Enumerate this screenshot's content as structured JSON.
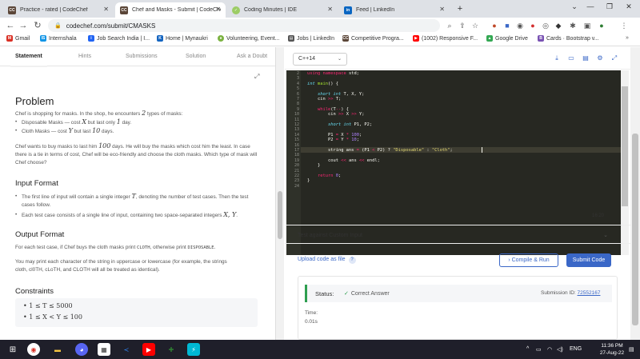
{
  "tabs": [
    {
      "title": "Practice - rated | CodeChef",
      "icon": "codechef-icon",
      "color": "#5b4638"
    },
    {
      "title": "Chef and Masks - Submit | CodeChef",
      "icon": "codechef-icon",
      "color": "#5b4638",
      "active": true
    },
    {
      "title": "Coding Minutes | IDE",
      "icon": "check-icon",
      "color": "#9ccc65"
    },
    {
      "title": "Feed | LinkedIn",
      "icon": "linkedin-icon",
      "color": "#0a66c2"
    }
  ],
  "address": {
    "url": "codechef.com/submit/CMASKS"
  },
  "bookmarks": [
    {
      "label": "Gmail",
      "icon": "gmail-icon",
      "color": "#d93025"
    },
    {
      "label": "Internshala",
      "icon": "internshala-icon",
      "color": "#1295e6"
    },
    {
      "label": "Job Search India | I...",
      "icon": "indeed-icon",
      "color": "#2164f3"
    },
    {
      "label": "Home | Mynaukri",
      "icon": "mynaukri-icon",
      "color": "#1565c0"
    },
    {
      "label": "Volunteering, Event...",
      "icon": "volunteer-icon",
      "color": "#7cb342"
    },
    {
      "label": "Jobs | LinkedIn",
      "icon": "briefcase-icon",
      "color": "#555555"
    },
    {
      "label": "Competitive Progra...",
      "icon": "codechef-icon",
      "color": "#5b4638"
    },
    {
      "label": "(1002) Responsive F...",
      "icon": "youtube-icon",
      "color": "#ff0000"
    },
    {
      "label": "Google Drive",
      "icon": "drive-icon",
      "color": "#34a853"
    },
    {
      "label": "Cards · Bootstrap v...",
      "icon": "bootstrap-icon",
      "color": "#7952b3"
    }
  ],
  "problem_tabs": [
    "Statement",
    "Hints",
    "Submissions",
    "Solution",
    "Ask a Doubt"
  ],
  "problem": {
    "title": "Problem",
    "intro_a": "Chef is shopping for masks. In the shop, he encounters",
    "intro_n": "2",
    "intro_b": "types of masks:",
    "mask1_a": "Disposable Masks — cost",
    "mask1_v": "X",
    "mask1_b": "but last only",
    "mask1_n": "1",
    "mask1_c": "day.",
    "mask2_a": "Cloth Masks — cost",
    "mask2_v": "Y",
    "mask2_b": "but last",
    "mask2_n": "10",
    "mask2_c": "days.",
    "body_a": "Chef wants to buy masks to last him",
    "body_n": "100",
    "body_b": "days. He will buy the masks which cost him the least. In case there is a tie in terms of cost, Chef will be eco-friendly and choose the cloth masks. Which type of mask will Chef choose?",
    "input_title": "Input Format",
    "input1_a": "The first line of input will contain a single integer",
    "input1_v": "T",
    "input1_b": ", denoting the number of test cases. Then the test cases follow.",
    "input2_a": "Each test case consists of a single line of input, containing two space-separated integers",
    "input2_v": "X, Y",
    "input2_b": ".",
    "output_title": "Output Format",
    "output_a": "For each test case, if Chef buys the cloth masks print",
    "output_cloth": "CLOTH",
    "output_b": ", otherwise print",
    "output_disp": "DISPOSABLE",
    "output_c": ".",
    "case_a": "You may print each character of the string in uppercase or lowercase (for example, the strings",
    "case_b": "cloth, cl0TH, cLoTH, and CLOTH will all be treated as identical).",
    "constraints_title": "Constraints",
    "constraint1": "1 ≤ T ≤ 5000",
    "constraint2": "1 ≤ X < Y ≤ 100"
  },
  "editor": {
    "language": "C++14",
    "cursor_position": "16:20",
    "line_numbers": [
      "2",
      "3",
      "4",
      "5",
      "6",
      "7",
      "8",
      "9",
      "10",
      "11",
      "12",
      "13",
      "14",
      "15",
      "16",
      "17",
      "18",
      "19",
      "20",
      "21",
      "22",
      "23",
      "24"
    ]
  },
  "custom_input_label": "Test against Custom Input",
  "upload_label": "Upload code as file",
  "run_label": "Compile & Run",
  "submit_label": "Submit Code",
  "result": {
    "status_label": "Status:",
    "status_value": "Correct Answer",
    "submission_label": "Submission ID:",
    "submission_id": "72552167",
    "time_label": "Time:",
    "time_value": "0.01s"
  },
  "taskbar": {
    "lang": "ENG",
    "time": "11:36 PM",
    "date": "27-Aug-22"
  }
}
